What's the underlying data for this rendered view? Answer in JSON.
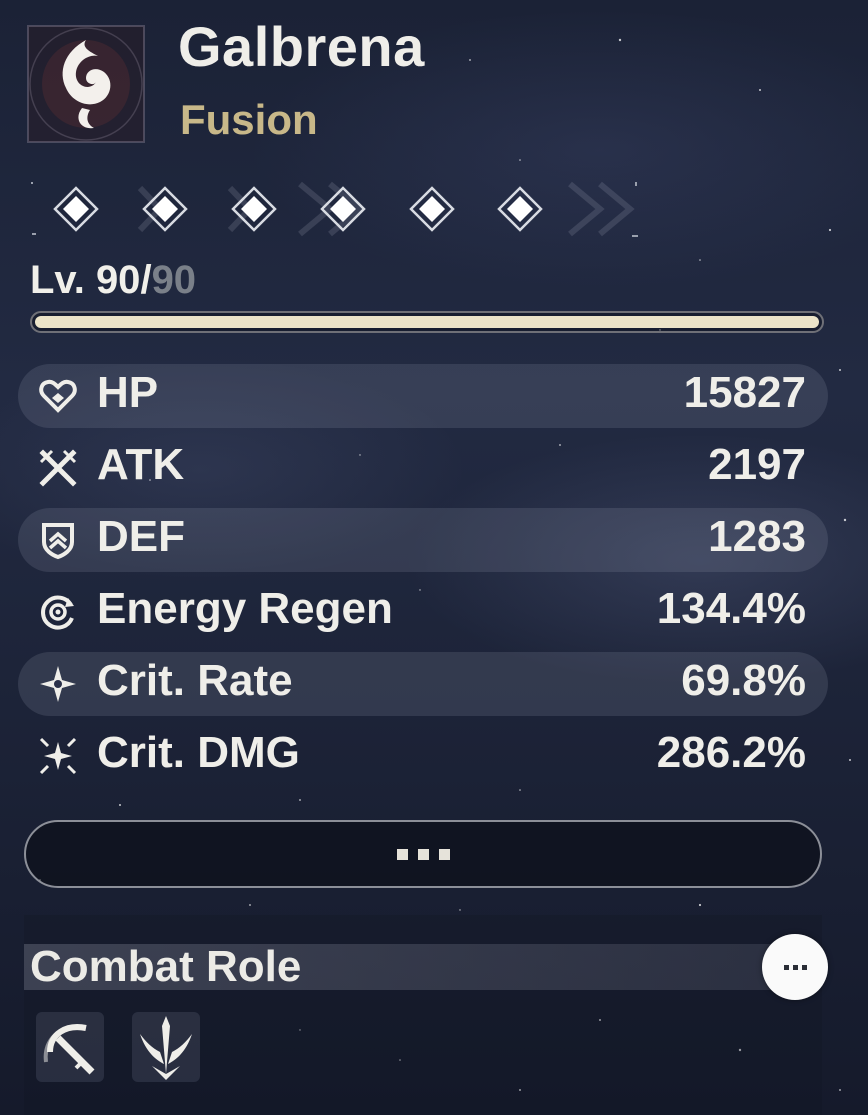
{
  "character": {
    "name": "Galbrena",
    "element": "Fusion",
    "element_icon": "fusion-flame-icon"
  },
  "sequence_nodes": {
    "total": 6,
    "unlocked": 6,
    "icon": "diamond-node-icon"
  },
  "level": {
    "prefix": "Lv. ",
    "current": "90",
    "separator": "/",
    "max": "90",
    "progress": 1.0
  },
  "stats": [
    {
      "icon": "heart-icon",
      "label": "HP",
      "value": "15827"
    },
    {
      "icon": "crossed-swords-icon",
      "label": "ATK",
      "value": "2197"
    },
    {
      "icon": "shield-icon",
      "label": "DEF",
      "value": "1283"
    },
    {
      "icon": "energy-regen-icon",
      "label": "Energy Regen",
      "value": "134.4%"
    },
    {
      "icon": "crit-rate-star-icon",
      "label": "Crit. Rate",
      "value": "69.8%"
    },
    {
      "icon": "crit-dmg-burst-icon",
      "label": "Crit. DMG",
      "value": "286.2%"
    }
  ],
  "more_button": {
    "icon": "ellipsis-icon"
  },
  "combat_role": {
    "title": "Combat Role",
    "more_icon": "ellipsis-icon",
    "roles": [
      {
        "icon": "sword-slash-icon"
      },
      {
        "icon": "trident-icon"
      }
    ]
  },
  "colors": {
    "accent_gold": "#c8b889",
    "text": "#efeee9",
    "level_bar": "#ece4c9",
    "max_level_text": "#7a8089"
  }
}
